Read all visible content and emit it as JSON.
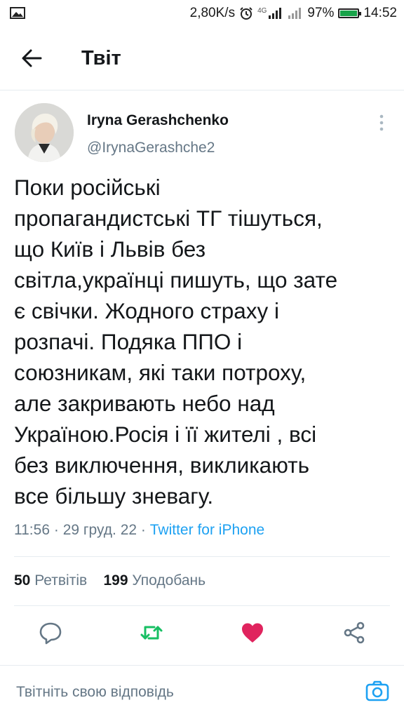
{
  "status_bar": {
    "speed": "2,80K/s",
    "network": "4G",
    "battery_percent": "97%",
    "battery_level": 0.97,
    "time": "14:52"
  },
  "header": {
    "title": "Твіт"
  },
  "tweet": {
    "author_name": "Iryna Gerashchenko",
    "author_handle": "@IrynaGerashche2",
    "lines": [
      "Поки російські",
      "пропагандистські ТГ тішуться,",
      "що Київ і Львів без",
      "світла,українці пишуть, що зате",
      "є свічки. Жодного страху і",
      "розпачі. Подяка ППО і",
      "союзникам, які таки потроху,",
      "але закривають небо над",
      "Україною.Росія і її жителі , всі",
      "без виключення, викликають",
      "все більшу зневагу."
    ],
    "time": "11:56",
    "separator": "·",
    "date": "29 груд. 22",
    "source": "Twitter for iPhone"
  },
  "stats": {
    "retweets_count": "50",
    "retweets_label": "Ретвітів",
    "likes_count": "199",
    "likes_label": "Уподобань"
  },
  "actions": [
    {
      "name": "reply",
      "icon": "comment-icon",
      "color": "#657786"
    },
    {
      "name": "retweet",
      "icon": "retweet-icon",
      "color": "#17bf63"
    },
    {
      "name": "like",
      "icon": "heart-icon",
      "color": "#e0245e"
    },
    {
      "name": "share",
      "icon": "share-icon",
      "color": "#657786"
    }
  ],
  "reply_bar": {
    "placeholder": "Твітніть свою відповідь",
    "accent": "#1da1f2"
  }
}
